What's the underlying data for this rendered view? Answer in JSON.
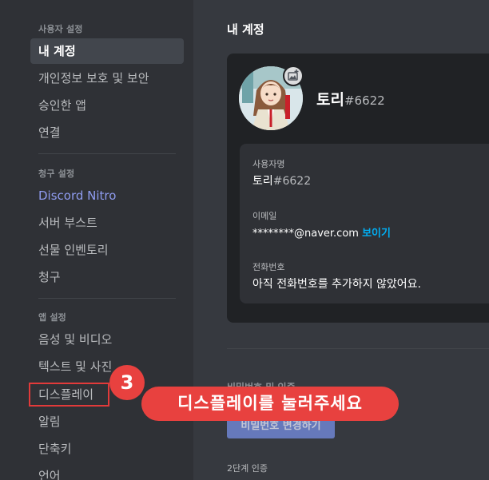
{
  "sidebar": {
    "user_settings_header": "사용자 설정",
    "user_items": [
      {
        "label": "내 계정"
      },
      {
        "label": "개인정보 보호 및 보안"
      },
      {
        "label": "승인한 앱"
      },
      {
        "label": "연결"
      }
    ],
    "billing_header": "청구 설정",
    "billing_items": [
      {
        "label": "Discord Nitro"
      },
      {
        "label": "서버 부스트"
      },
      {
        "label": "선물 인벤토리"
      },
      {
        "label": "청구"
      }
    ],
    "app_header": "앱 설정",
    "app_items": [
      {
        "label": "음성 및 비디오"
      },
      {
        "label": "텍스트 및 사진"
      },
      {
        "label": "디스플레이"
      },
      {
        "label": "알림"
      },
      {
        "label": "단축키"
      },
      {
        "label": "언어"
      }
    ]
  },
  "main": {
    "title": "내 계정",
    "profile": {
      "username": "토리",
      "discriminator": "#6622"
    },
    "fields": {
      "username_label": "사용자명",
      "username_value": "토리",
      "username_disc": "#6622",
      "email_label": "이메일",
      "email_value": "********@naver.com",
      "email_reveal": "보이기",
      "phone_label": "전화번호",
      "phone_value": "아직 전화번호를 추가하지 않았어요."
    },
    "password_header": "비밀번호 및 인증",
    "password_button": "비밀번호 변경하기",
    "tfa_header": "2단계 인증"
  },
  "annotation": {
    "number": "3",
    "text": "디스플레이를 눌러주세요"
  },
  "colors": {
    "sidebar_bg": "#2f3136",
    "main_bg": "#36393f",
    "card_bg": "#202225",
    "accent_blurple": "#7289da",
    "link_blue": "#00aff4",
    "annotation_red": "#e8413f"
  }
}
